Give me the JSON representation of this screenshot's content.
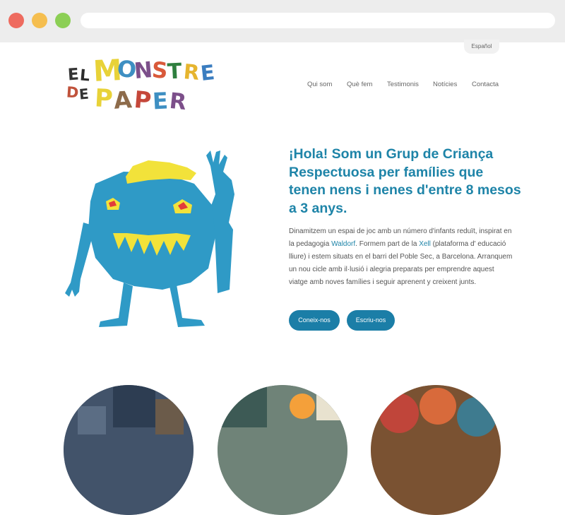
{
  "language": {
    "label": "Español"
  },
  "logo": {
    "line1": [
      "E",
      "L",
      "M",
      "O",
      "N",
      "S",
      "T",
      "R",
      "E"
    ],
    "line2": [
      "D",
      "E",
      "P",
      "A",
      "P",
      "E",
      "R"
    ]
  },
  "nav": {
    "items": [
      {
        "label": "Qui som"
      },
      {
        "label": "Què fem"
      },
      {
        "label": "Testimonis"
      },
      {
        "label": "Notícies"
      },
      {
        "label": "Contacta"
      }
    ]
  },
  "hero": {
    "headline": "¡Hola! Som un Grup de Criança Respectuosa per famílies que tenen nens i nenes d'entre 8 mesos a 3 anys.",
    "para_part1": "Dinamitzem un espai de joc amb un número d'infants reduït, inspirat en la pedagogia ",
    "link1": "Waldorf",
    "para_part2": ". Formem part de la ",
    "link2": "Xell",
    "para_part3": " (plataforma d' educació lliure) i estem situats en el barri del Poble Sec, a Barcelona. Arranquem un nou cicle amb il·lusió i alegria preparats per emprendre aquest viatge amb noves famílies i seguir aprenent y creixent junts.",
    "button1": "Coneix-nos",
    "button2": "Escriu-nos"
  },
  "colors": {
    "accent": "#1e84a8",
    "button": "#1b7ea7",
    "monster_body": "#2f9ac6",
    "monster_hair": "#f2e23a"
  }
}
